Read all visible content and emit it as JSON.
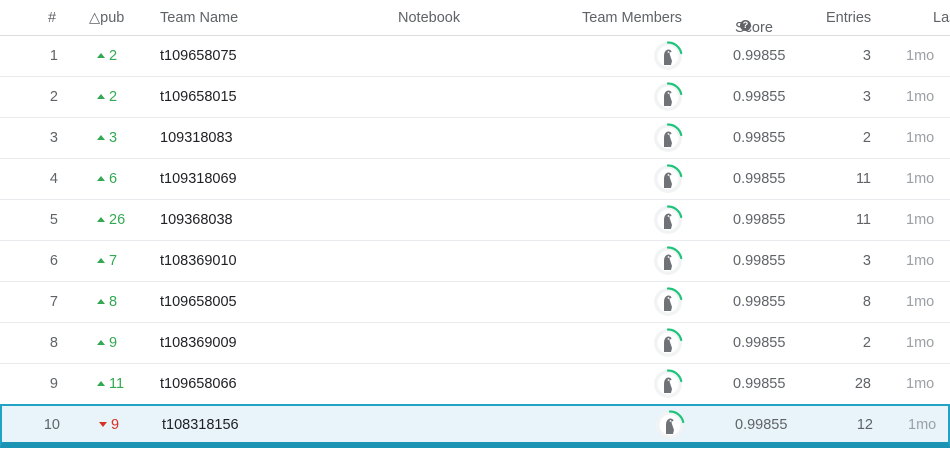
{
  "header": {
    "rank": "#",
    "delta": "△pub",
    "team": "Team Name",
    "notebook": "Notebook",
    "members": "Team Members",
    "score": "Score",
    "entries": "Entries",
    "last": "Last"
  },
  "rows": [
    {
      "rank": "1",
      "delta": "2",
      "dir": "up",
      "team": "t109658075",
      "score": "0.99855",
      "entries": "3",
      "last": "1mo"
    },
    {
      "rank": "2",
      "delta": "2",
      "dir": "up",
      "team": "t109658015",
      "score": "0.99855",
      "entries": "3",
      "last": "1mo"
    },
    {
      "rank": "3",
      "delta": "3",
      "dir": "up",
      "team": "109318083",
      "score": "0.99855",
      "entries": "2",
      "last": "1mo"
    },
    {
      "rank": "4",
      "delta": "6",
      "dir": "up",
      "team": "t109318069",
      "score": "0.99855",
      "entries": "11",
      "last": "1mo"
    },
    {
      "rank": "5",
      "delta": "26",
      "dir": "up",
      "team": "109368038",
      "score": "0.99855",
      "entries": "11",
      "last": "1mo"
    },
    {
      "rank": "6",
      "delta": "7",
      "dir": "up",
      "team": "t108369010",
      "score": "0.99855",
      "entries": "3",
      "last": "1mo"
    },
    {
      "rank": "7",
      "delta": "8",
      "dir": "up",
      "team": "t109658005",
      "score": "0.99855",
      "entries": "8",
      "last": "1mo"
    },
    {
      "rank": "8",
      "delta": "9",
      "dir": "up",
      "team": "t108369009",
      "score": "0.99855",
      "entries": "2",
      "last": "1mo"
    },
    {
      "rank": "9",
      "delta": "11",
      "dir": "up",
      "team": "t109658066",
      "score": "0.99855",
      "entries": "28",
      "last": "1mo"
    },
    {
      "rank": "10",
      "delta": "9",
      "dir": "down",
      "team": "t108318156",
      "score": "0.99855",
      "entries": "12",
      "last": "1mo",
      "selected": true
    }
  ],
  "colors": {
    "up": "#34a853",
    "down": "#d93025",
    "selected_border": "#20a3c5",
    "selected_bg": "#e8f4f9",
    "avatar_ring": "#1ec47a"
  },
  "icons": {
    "help": "help-circle-icon",
    "avatar": "default-user-avatar-icon"
  }
}
